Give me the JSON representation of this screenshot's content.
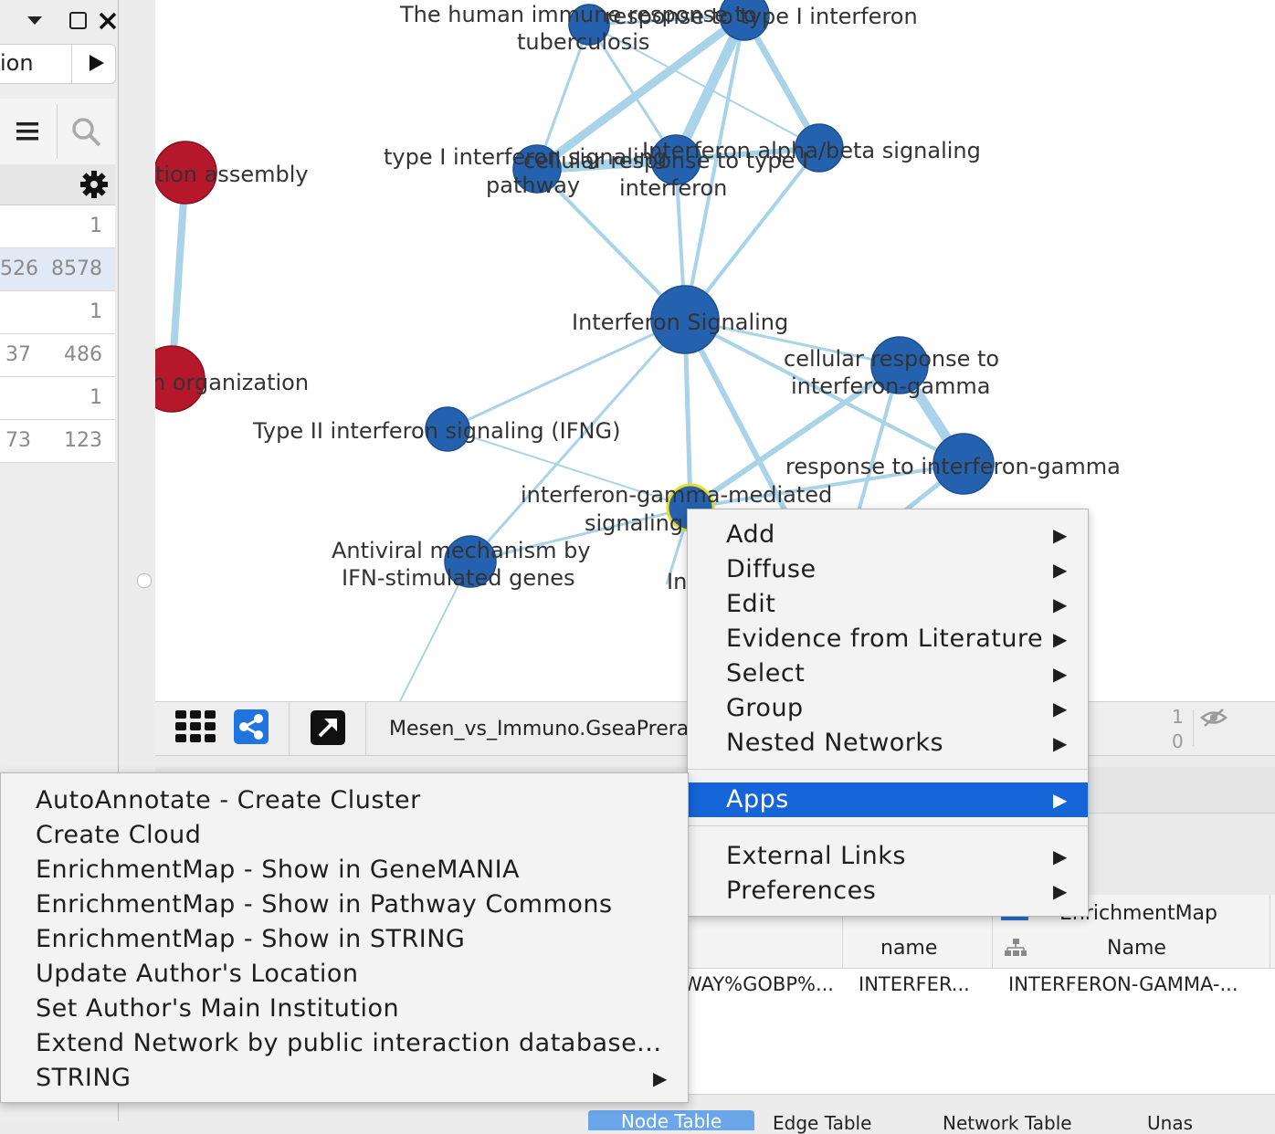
{
  "left_panel": {
    "control_label": "ion",
    "rows": [
      {
        "a": "",
        "b": "1"
      },
      {
        "a": "526",
        "b": "8578"
      },
      {
        "a": "",
        "b": "1"
      },
      {
        "a": "37",
        "b": "486"
      },
      {
        "a": "",
        "b": "1"
      },
      {
        "a": "73",
        "b": "123"
      }
    ]
  },
  "network": {
    "labels": {
      "human_immune_1": "The human immune response to",
      "human_immune_2": "tuberculosis",
      "resp_type1": "response to type I interferon",
      "type1_pathway_1": "type I interferon signaling",
      "type1_pathway_2": "pathway",
      "cellular_type1_1": "cellular response to type I",
      "cellular_type1_2": "interferon",
      "alpha_beta": "Interferon alpha/beta signaling",
      "ifn_signaling": "Interferon Signaling",
      "cell_gamma_1": "cellular response to",
      "cell_gamma_2": "interferon-gamma",
      "type2": "Type II interferon signaling (IFNG)",
      "resp_gamma": "response to interferon-gamma",
      "gamma_mediated_1": "interferon-gamma-mediated",
      "gamma_mediated_2": "signaling",
      "antiviral_1": "Antiviral mechanism by",
      "antiviral_2": "IFN-stimulated genes",
      "in_partial": "In",
      "red_assembly": "tion assembly",
      "red_org": "n organization"
    }
  },
  "toolbar": {
    "network_title": "Mesen_vs_Immuno.GseaPreran",
    "count_top": "1",
    "count_bottom": "0"
  },
  "table": {
    "col_name_header": "name",
    "col_em_header_top": "EnrichmentMap",
    "col_em_header_bottom": "Name",
    "cell_first": "WAY%GOBP%...",
    "cell_name": "INTERFER...",
    "cell_em_name": "INTERFERON-GAMMA-...",
    "tabs": [
      "Node Table",
      "Edge Table",
      "Network Table",
      "Unas"
    ]
  },
  "context_menu": {
    "items": [
      {
        "label": "Add",
        "submenu": true
      },
      {
        "label": "Diffuse",
        "submenu": true
      },
      {
        "label": "Edit",
        "submenu": true
      },
      {
        "label": "Evidence from Literature",
        "submenu": true
      },
      {
        "label": "Select",
        "submenu": true
      },
      {
        "label": "Group",
        "submenu": true
      },
      {
        "label": "Nested Networks",
        "submenu": true
      },
      {
        "label": "Apps",
        "submenu": true,
        "active": true
      },
      {
        "label": "External Links",
        "submenu": true
      },
      {
        "label": "Preferences",
        "submenu": true
      }
    ],
    "arrow_glyph": "▶"
  },
  "apps_submenu": {
    "items": [
      {
        "label": "AutoAnnotate - Create Cluster"
      },
      {
        "label": "Create Cloud"
      },
      {
        "label": "EnrichmentMap - Show in GeneMANIA"
      },
      {
        "label": "EnrichmentMap - Show in Pathway Commons"
      },
      {
        "label": "EnrichmentMap - Show in STRING"
      },
      {
        "label": "Update Author's Location"
      },
      {
        "label": "Set Author's Main Institution"
      },
      {
        "label": "Extend Network by public interaction database..."
      },
      {
        "label": "STRING",
        "submenu": true
      }
    ]
  },
  "colors": {
    "node_blue": "#2462b0",
    "node_red": "#b5172b",
    "edge": "#a8d3e8",
    "menu_highlight": "#1565d8"
  },
  "icons": [
    "dropdown-icon",
    "maximize-icon",
    "close-icon",
    "play-icon",
    "menu-icon",
    "search-icon",
    "gear-icon",
    "grid-icon",
    "share-icon",
    "export-icon",
    "eye-hidden-icon"
  ]
}
